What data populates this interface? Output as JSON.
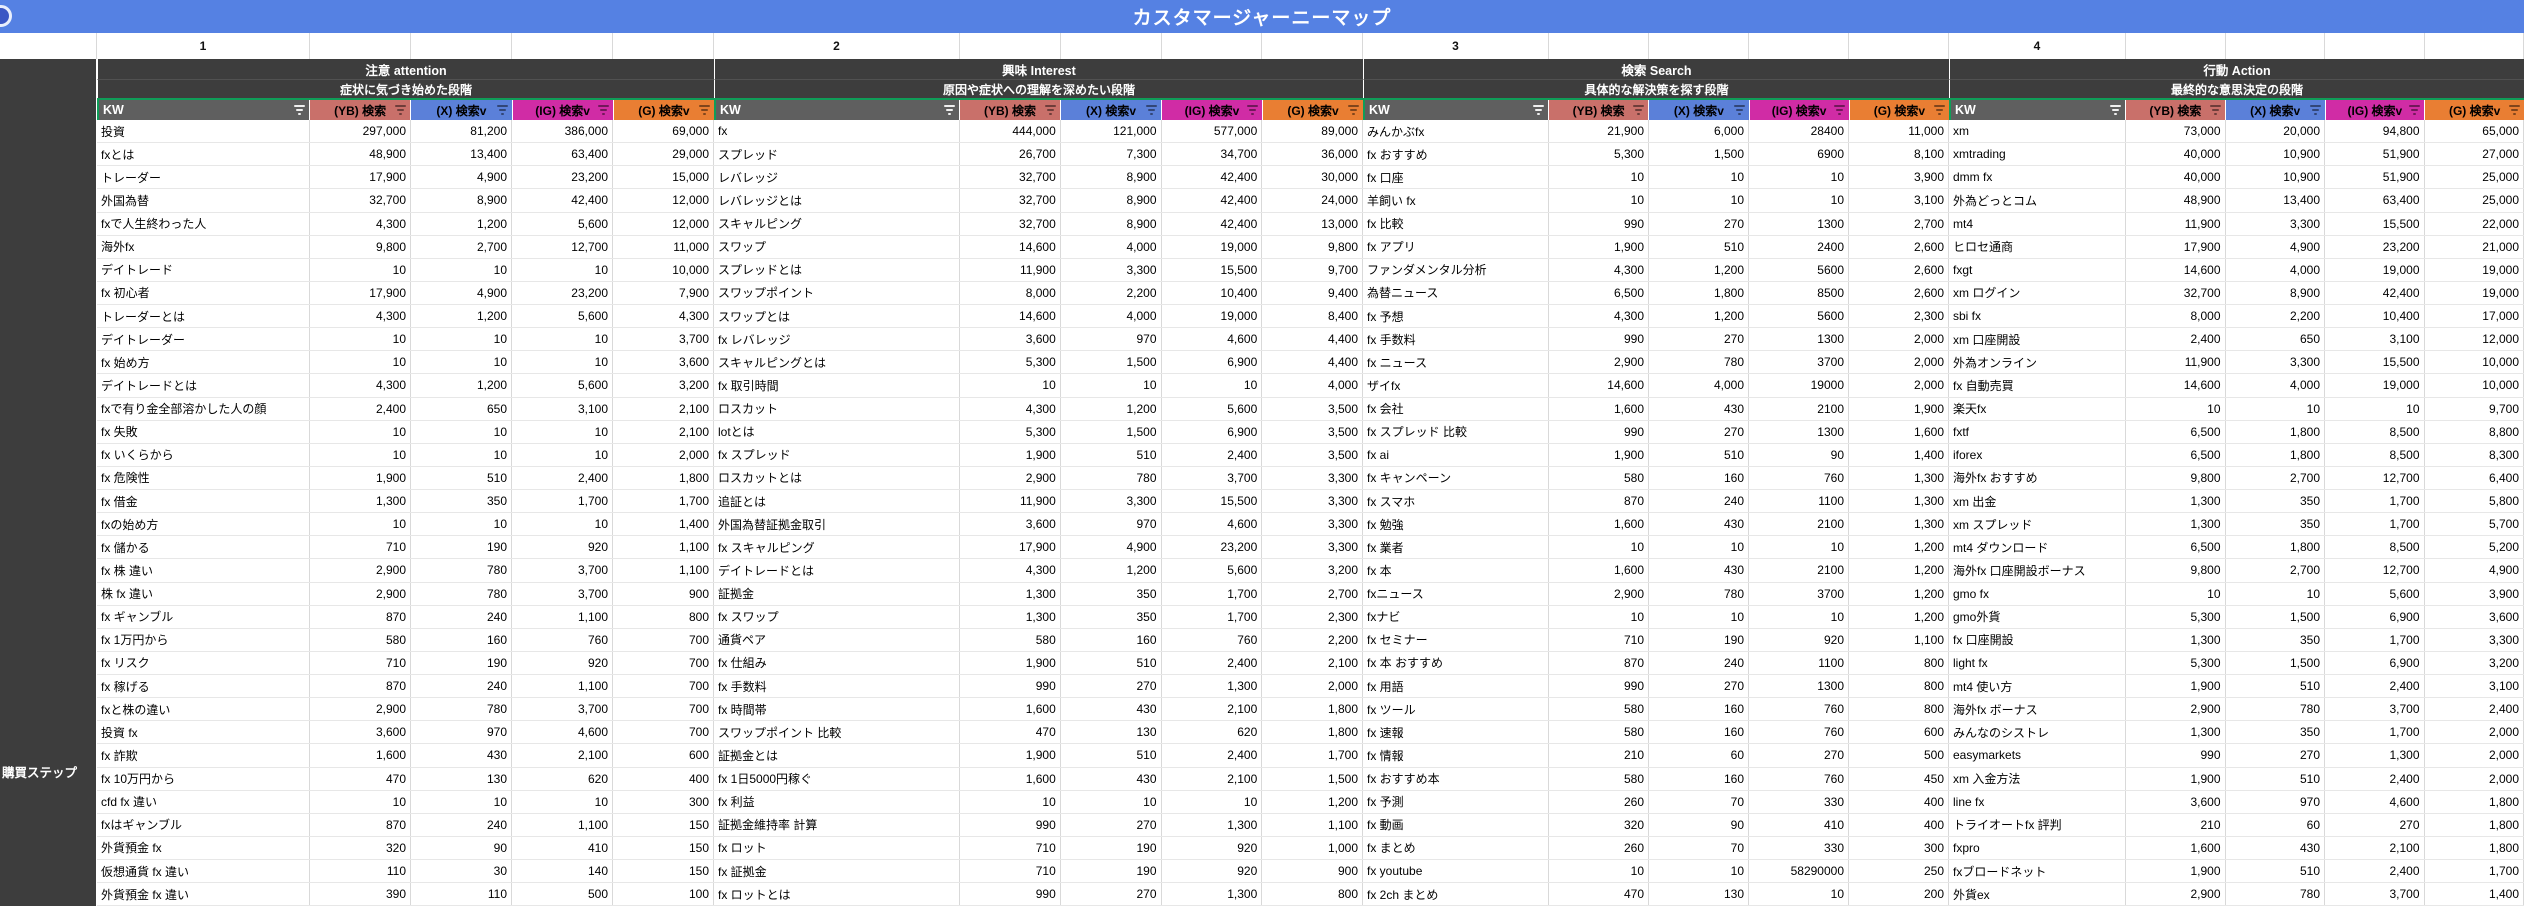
{
  "title": "カスタマージャーニーマップ",
  "sidebar": {
    "label": "購買ステップ"
  },
  "columns": {
    "kw": "KW",
    "yb": "(YB) 検索",
    "x": "(X) 検索v",
    "ig": "(IG) 検索v",
    "g": "(G) 検索v"
  },
  "colors": {
    "title_bar": "#5581e3",
    "dark_band": "#3d3d3d",
    "kw_header": "#5f5f5f",
    "selection_green": "#0f9d58",
    "yb": "#c9706a",
    "x": "#5b80d9",
    "ig": "#d02ca5",
    "g": "#e97e33"
  },
  "groups": [
    {
      "number": "1",
      "stage": "注意 attention",
      "desc": "症状に気づき始めた段階",
      "rows": [
        [
          "投資",
          "297,000",
          "81,200",
          "386,000",
          "69,000"
        ],
        [
          "fxとは",
          "48,900",
          "13,400",
          "63,400",
          "29,000"
        ],
        [
          "トレーダー",
          "17,900",
          "4,900",
          "23,200",
          "15,000"
        ],
        [
          "外国為替",
          "32,700",
          "8,900",
          "42,400",
          "12,000"
        ],
        [
          "fxで人生終わった人",
          "4,300",
          "1,200",
          "5,600",
          "12,000"
        ],
        [
          "海外fx",
          "9,800",
          "2,700",
          "12,700",
          "11,000"
        ],
        [
          "デイトレード",
          "10",
          "10",
          "10",
          "10,000"
        ],
        [
          "fx 初心者",
          "17,900",
          "4,900",
          "23,200",
          "7,900"
        ],
        [
          "トレーダーとは",
          "4,300",
          "1,200",
          "5,600",
          "4,300"
        ],
        [
          "デイトレーダー",
          "10",
          "10",
          "10",
          "3,700"
        ],
        [
          "fx 始め方",
          "10",
          "10",
          "10",
          "3,600"
        ],
        [
          "デイトレードとは",
          "4,300",
          "1,200",
          "5,600",
          "3,200"
        ],
        [
          "fxで有り金全部溶かした人の顔",
          "2,400",
          "650",
          "3,100",
          "2,100"
        ],
        [
          "fx 失敗",
          "10",
          "10",
          "10",
          "2,100"
        ],
        [
          "fx いくらから",
          "10",
          "10",
          "10",
          "2,000"
        ],
        [
          "fx 危険性",
          "1,900",
          "510",
          "2,400",
          "1,800"
        ],
        [
          "fx 借金",
          "1,300",
          "350",
          "1,700",
          "1,700"
        ],
        [
          "fxの始め方",
          "10",
          "10",
          "10",
          "1,400"
        ],
        [
          "fx 儲かる",
          "710",
          "190",
          "920",
          "1,100"
        ],
        [
          "fx 株 違い",
          "2,900",
          "780",
          "3,700",
          "1,100"
        ],
        [
          "株 fx 違い",
          "2,900",
          "780",
          "3,700",
          "900"
        ],
        [
          "fx ギャンブル",
          "870",
          "240",
          "1,100",
          "800"
        ],
        [
          "fx 1万円から",
          "580",
          "160",
          "760",
          "700"
        ],
        [
          "fx リスク",
          "710",
          "190",
          "920",
          "700"
        ],
        [
          "fx 稼げる",
          "870",
          "240",
          "1,100",
          "700"
        ],
        [
          "fxと株の違い",
          "2,900",
          "780",
          "3,700",
          "700"
        ],
        [
          "投資 fx",
          "3,600",
          "970",
          "4,600",
          "700"
        ],
        [
          "fx 詐欺",
          "1,600",
          "430",
          "2,100",
          "600"
        ],
        [
          "fx 10万円から",
          "470",
          "130",
          "620",
          "400"
        ],
        [
          "cfd fx 違い",
          "10",
          "10",
          "10",
          "300"
        ],
        [
          "fxはギャンブル",
          "870",
          "240",
          "1,100",
          "150"
        ],
        [
          "外貨預金 fx",
          "320",
          "90",
          "410",
          "150"
        ],
        [
          "仮想通貨 fx 違い",
          "110",
          "30",
          "140",
          "150"
        ],
        [
          "外貨預金 fx 違い",
          "390",
          "110",
          "500",
          "100"
        ]
      ]
    },
    {
      "number": "2",
      "stage": "興味 Interest",
      "desc": "原因や症状への理解を深めたい段階",
      "rows": [
        [
          "fx",
          "444,000",
          "121,000",
          "577,000",
          "89,000"
        ],
        [
          "スプレッド",
          "26,700",
          "7,300",
          "34,700",
          "36,000"
        ],
        [
          "レバレッジ",
          "32,700",
          "8,900",
          "42,400",
          "30,000"
        ],
        [
          "レバレッジとは",
          "32,700",
          "8,900",
          "42,400",
          "24,000"
        ],
        [
          "スキャルピング",
          "32,700",
          "8,900",
          "42,400",
          "13,000"
        ],
        [
          "スワップ",
          "14,600",
          "4,000",
          "19,000",
          "9,800"
        ],
        [
          "スプレッドとは",
          "11,900",
          "3,300",
          "15,500",
          "9,700"
        ],
        [
          "スワップポイント",
          "8,000",
          "2,200",
          "10,400",
          "9,400"
        ],
        [
          "スワップとは",
          "14,600",
          "4,000",
          "19,000",
          "8,400"
        ],
        [
          "fx レバレッジ",
          "3,600",
          "970",
          "4,600",
          "4,400"
        ],
        [
          "スキャルピングとは",
          "5,300",
          "1,500",
          "6,900",
          "4,400"
        ],
        [
          "fx 取引時間",
          "10",
          "10",
          "10",
          "4,000"
        ],
        [
          "ロスカット",
          "4,300",
          "1,200",
          "5,600",
          "3,500"
        ],
        [
          "lotとは",
          "5,300",
          "1,500",
          "6,900",
          "3,500"
        ],
        [
          "fx スプレッド",
          "1,900",
          "510",
          "2,400",
          "3,500"
        ],
        [
          "ロスカットとは",
          "2,900",
          "780",
          "3,700",
          "3,300"
        ],
        [
          "追証とは",
          "11,900",
          "3,300",
          "15,500",
          "3,300"
        ],
        [
          "外国為替証拠金取引",
          "3,600",
          "970",
          "4,600",
          "3,300"
        ],
        [
          "fx スキャルピング",
          "17,900",
          "4,900",
          "23,200",
          "3,300"
        ],
        [
          "デイトレードとは",
          "4,300",
          "1,200",
          "5,600",
          "3,200"
        ],
        [
          "証拠金",
          "1,300",
          "350",
          "1,700",
          "2,700"
        ],
        [
          "fx スワップ",
          "1,300",
          "350",
          "1,700",
          "2,300"
        ],
        [
          "通貨ペア",
          "580",
          "160",
          "760",
          "2,200"
        ],
        [
          "fx 仕組み",
          "1,900",
          "510",
          "2,400",
          "2,100"
        ],
        [
          "fx 手数料",
          "990",
          "270",
          "1,300",
          "2,000"
        ],
        [
          "fx 時間帯",
          "1,600",
          "430",
          "2,100",
          "1,800"
        ],
        [
          "スワップポイント 比較",
          "470",
          "130",
          "620",
          "1,800"
        ],
        [
          "証拠金とは",
          "1,900",
          "510",
          "2,400",
          "1,700"
        ],
        [
          "fx 1日5000円稼ぐ",
          "1,600",
          "430",
          "2,100",
          "1,500"
        ],
        [
          "fx 利益",
          "10",
          "10",
          "10",
          "1,200"
        ],
        [
          "証拠金維持率 計算",
          "990",
          "270",
          "1,300",
          "1,100"
        ],
        [
          "fx ロット",
          "710",
          "190",
          "920",
          "1,000"
        ],
        [
          "fx 証拠金",
          "710",
          "190",
          "920",
          "900"
        ],
        [
          "fx ロットとは",
          "990",
          "270",
          "1,300",
          "800"
        ]
      ]
    },
    {
      "number": "3",
      "stage": "検索 Search",
      "desc": "具体的な解決策を探す段階",
      "rows": [
        [
          "みんかぶfx",
          "21,900",
          "6,000",
          "28400",
          "11,000"
        ],
        [
          "fx おすすめ",
          "5,300",
          "1,500",
          "6900",
          "8,100"
        ],
        [
          "fx 口座",
          "10",
          "10",
          "10",
          "3,900"
        ],
        [
          "羊飼い fx",
          "10",
          "10",
          "10",
          "3,100"
        ],
        [
          "fx 比較",
          "990",
          "270",
          "1300",
          "2,700"
        ],
        [
          "fx アプリ",
          "1,900",
          "510",
          "2400",
          "2,600"
        ],
        [
          "ファンダメンタル分析",
          "4,300",
          "1,200",
          "5600",
          "2,600"
        ],
        [
          "為替ニュース",
          "6,500",
          "1,800",
          "8500",
          "2,600"
        ],
        [
          "fx 予想",
          "4,300",
          "1,200",
          "5600",
          "2,300"
        ],
        [
          "fx 手数料",
          "990",
          "270",
          "1300",
          "2,000"
        ],
        [
          "fx ニュース",
          "2,900",
          "780",
          "3700",
          "2,000"
        ],
        [
          "ザイfx",
          "14,600",
          "4,000",
          "19000",
          "2,000"
        ],
        [
          "fx 会社",
          "1,600",
          "430",
          "2100",
          "1,900"
        ],
        [
          "fx スプレッド 比較",
          "990",
          "270",
          "1300",
          "1,600"
        ],
        [
          "fx ai",
          "1,900",
          "510",
          "90",
          "1,400"
        ],
        [
          "fx キャンペーン",
          "580",
          "160",
          "760",
          "1,300"
        ],
        [
          "fx スマホ",
          "870",
          "240",
          "1100",
          "1,300"
        ],
        [
          "fx 勉強",
          "1,600",
          "430",
          "2100",
          "1,300"
        ],
        [
          "fx 業者",
          "10",
          "10",
          "10",
          "1,200"
        ],
        [
          "fx 本",
          "1,600",
          "430",
          "2100",
          "1,200"
        ],
        [
          "fxニュース",
          "2,900",
          "780",
          "3700",
          "1,200"
        ],
        [
          "fxナビ",
          "10",
          "10",
          "10",
          "1,200"
        ],
        [
          "fx セミナー",
          "710",
          "190",
          "920",
          "1,100"
        ],
        [
          "fx 本 おすすめ",
          "870",
          "240",
          "1100",
          "800"
        ],
        [
          "fx 用語",
          "990",
          "270",
          "1300",
          "800"
        ],
        [
          "fx ツール",
          "580",
          "160",
          "760",
          "800"
        ],
        [
          "fx 速報",
          "580",
          "160",
          "760",
          "600"
        ],
        [
          "fx 情報",
          "210",
          "60",
          "270",
          "500"
        ],
        [
          "fx おすすめ本",
          "580",
          "160",
          "760",
          "450"
        ],
        [
          "fx 予測",
          "260",
          "70",
          "330",
          "400"
        ],
        [
          "fx 動画",
          "320",
          "90",
          "410",
          "400"
        ],
        [
          "fx まとめ",
          "260",
          "70",
          "330",
          "300"
        ],
        [
          "fx youtube",
          "10",
          "10",
          "58290000",
          "250"
        ],
        [
          "fx 2ch まとめ",
          "470",
          "130",
          "10",
          "200"
        ]
      ]
    },
    {
      "number": "4",
      "stage": "行動 Action",
      "desc": "最終的な意思決定の段階",
      "rows": [
        [
          "xm",
          "73,000",
          "20,000",
          "94,800",
          "65,000"
        ],
        [
          "xmtrading",
          "40,000",
          "10,900",
          "51,900",
          "27,000"
        ],
        [
          "dmm fx",
          "40,000",
          "10,900",
          "51,900",
          "25,000"
        ],
        [
          "外為どっとコム",
          "48,900",
          "13,400",
          "63,400",
          "25,000"
        ],
        [
          "mt4",
          "11,900",
          "3,300",
          "15,500",
          "22,000"
        ],
        [
          "ヒロセ通商",
          "17,900",
          "4,900",
          "23,200",
          "21,000"
        ],
        [
          "fxgt",
          "14,600",
          "4,000",
          "19,000",
          "19,000"
        ],
        [
          "xm ログイン",
          "32,700",
          "8,900",
          "42,400",
          "19,000"
        ],
        [
          "sbi fx",
          "8,000",
          "2,200",
          "10,400",
          "17,000"
        ],
        [
          "xm 口座開設",
          "2,400",
          "650",
          "3,100",
          "12,000"
        ],
        [
          "外為オンライン",
          "11,900",
          "3,300",
          "15,500",
          "10,000"
        ],
        [
          "fx 自動売買",
          "14,600",
          "4,000",
          "19,000",
          "10,000"
        ],
        [
          "楽天fx",
          "10",
          "10",
          "10",
          "9,700"
        ],
        [
          "fxtf",
          "6,500",
          "1,800",
          "8,500",
          "8,800"
        ],
        [
          "iforex",
          "6,500",
          "1,800",
          "8,500",
          "8,300"
        ],
        [
          "海外fx おすすめ",
          "9,800",
          "2,700",
          "12,700",
          "6,400"
        ],
        [
          "xm 出金",
          "1,300",
          "350",
          "1,700",
          "5,800"
        ],
        [
          "xm スプレッド",
          "1,300",
          "350",
          "1,700",
          "5,700"
        ],
        [
          "mt4 ダウンロード",
          "6,500",
          "1,800",
          "8,500",
          "5,200"
        ],
        [
          "海外fx 口座開設ボーナス",
          "9,800",
          "2,700",
          "12,700",
          "4,900"
        ],
        [
          "gmo fx",
          "10",
          "10",
          "5,600",
          "3,900"
        ],
        [
          "gmo外貨",
          "5,300",
          "1,500",
          "6,900",
          "3,600"
        ],
        [
          "fx 口座開設",
          "1,300",
          "350",
          "1,700",
          "3,300"
        ],
        [
          "light fx",
          "5,300",
          "1,500",
          "6,900",
          "3,200"
        ],
        [
          "mt4 使い方",
          "1,900",
          "510",
          "2,400",
          "3,100"
        ],
        [
          "海外fx ボーナス",
          "2,900",
          "780",
          "3,700",
          "2,400"
        ],
        [
          "みんなのシストレ",
          "1,300",
          "350",
          "1,700",
          "2,000"
        ],
        [
          "easymarkets",
          "990",
          "270",
          "1,300",
          "2,000"
        ],
        [
          "xm 入金方法",
          "1,900",
          "510",
          "2,400",
          "2,000"
        ],
        [
          "line fx",
          "3,600",
          "970",
          "4,600",
          "1,800"
        ],
        [
          "トライオートfx 評判",
          "210",
          "60",
          "270",
          "1,800"
        ],
        [
          "fxpro",
          "1,600",
          "430",
          "2,100",
          "1,800"
        ],
        [
          "fxブロードネット",
          "1,900",
          "510",
          "2,400",
          "1,700"
        ],
        [
          "外貨ex",
          "2,900",
          "780",
          "3,700",
          "1,400"
        ]
      ]
    }
  ]
}
